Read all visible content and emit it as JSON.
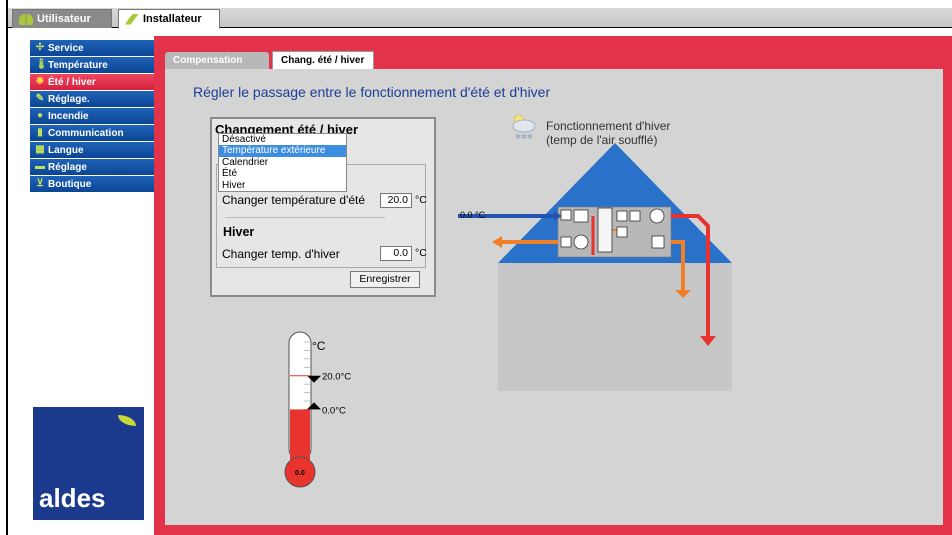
{
  "top_tabs": [
    {
      "label": "Utilisateur",
      "icon": "users-icon"
    },
    {
      "label": "Installateur",
      "icon": "tool-icon"
    }
  ],
  "sidebar": {
    "items": [
      {
        "label": "Service",
        "icon": "fan-icon"
      },
      {
        "label": "Température",
        "icon": "thermometer-icon"
      },
      {
        "label": "Été / hiver",
        "icon": "sun-icon",
        "active": true
      },
      {
        "label": "Réglage.",
        "icon": "pen-icon"
      },
      {
        "label": "Incendie",
        "icon": "fire-icon"
      },
      {
        "label": "Communication",
        "icon": "plug-icon"
      },
      {
        "label": "Langue",
        "icon": "flag-icon"
      },
      {
        "label": "Réglage",
        "icon": "folder-icon"
      },
      {
        "label": "Boutique",
        "icon": "cart-icon"
      }
    ]
  },
  "logo": {
    "text": "aldes"
  },
  "subtabs": [
    {
      "label": "Compensation"
    },
    {
      "label": "Chang. été / hiver",
      "active": true
    }
  ],
  "page_title": "Régler le passage entre le fonctionnement d'été et d'hiver",
  "settings": {
    "title": "Changement été / hiver",
    "dropdown_options": [
      "Désactivé",
      "Température extérieure",
      "Calendrier",
      "Été",
      "Hiver"
    ],
    "dropdown_selected": "Température extérieure",
    "summer_label": "Changer température d'été",
    "summer_value": "20.0",
    "winter_title": "Hiver",
    "winter_label": "Changer temp. d'hiver",
    "winter_value": "0.0",
    "unit": "°C",
    "save_label": "Enregistrer"
  },
  "status": {
    "text": "Fonctionnement d'hiver (temp de l'air soufflé)",
    "icon": "cloud-snow-icon"
  },
  "diagram": {
    "outdoor_temp": "0.0 °C"
  },
  "thermometer": {
    "unit_label": "°C",
    "summer_mark": "20.0°C",
    "winter_mark": "0.0°C",
    "current": "0.0",
    "current_value": 0.0,
    "scale_min": -30,
    "scale_max": 40
  },
  "colors": {
    "sidebar_blue": "#0b4595",
    "active_red": "#e2334a",
    "title_blue": "#1c3e95",
    "roof_blue": "#2a72c9",
    "duct_blue": "#2253b3",
    "duct_red": "#e8332e",
    "duct_orange": "#f07f2a"
  }
}
